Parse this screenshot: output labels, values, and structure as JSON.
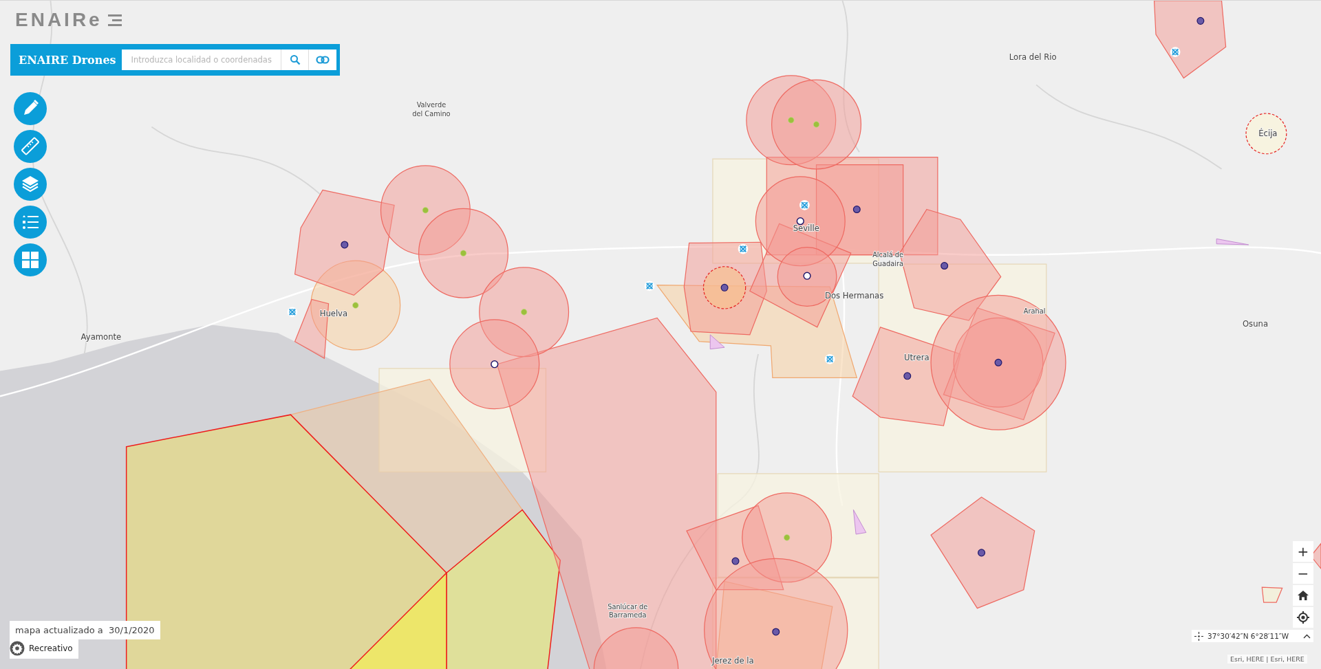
{
  "logo": "ENAIRe",
  "app": {
    "title": "ENAIRE Drones",
    "search": {
      "placeholder": "Introduzca localidad o coordenadas"
    }
  },
  "map": {
    "labels": [
      {
        "lines": [
          "Lora del Rio"
        ]
      },
      {
        "lines": [
          "Valverde",
          "del Camino"
        ]
      },
      {
        "lines": [
          "Écija"
        ]
      },
      {
        "lines": [
          "Seville"
        ]
      },
      {
        "lines": [
          "Alcalá de",
          "Guadaira"
        ]
      },
      {
        "lines": [
          "Dos Hermanas"
        ]
      },
      {
        "lines": [
          "Huelva"
        ]
      },
      {
        "lines": [
          "Ayamonte"
        ]
      },
      {
        "lines": [
          "Arahal"
        ]
      },
      {
        "lines": [
          "Osuna"
        ]
      },
      {
        "lines": [
          "Utrera"
        ]
      },
      {
        "lines": [
          "Sanlúcar de",
          "Barrameda"
        ]
      },
      {
        "lines": [
          "Jerez de la"
        ]
      }
    ]
  },
  "update": {
    "label": "mapa actualizado a",
    "date": "30/1/2020"
  },
  "profile": {
    "label": "Recreativo"
  },
  "zoom": {
    "in": "+",
    "out": "−"
  },
  "coordinates": "37°30′42″N 6°28′11″W",
  "attribution": "Esri, HERE | Esri, HERE"
}
